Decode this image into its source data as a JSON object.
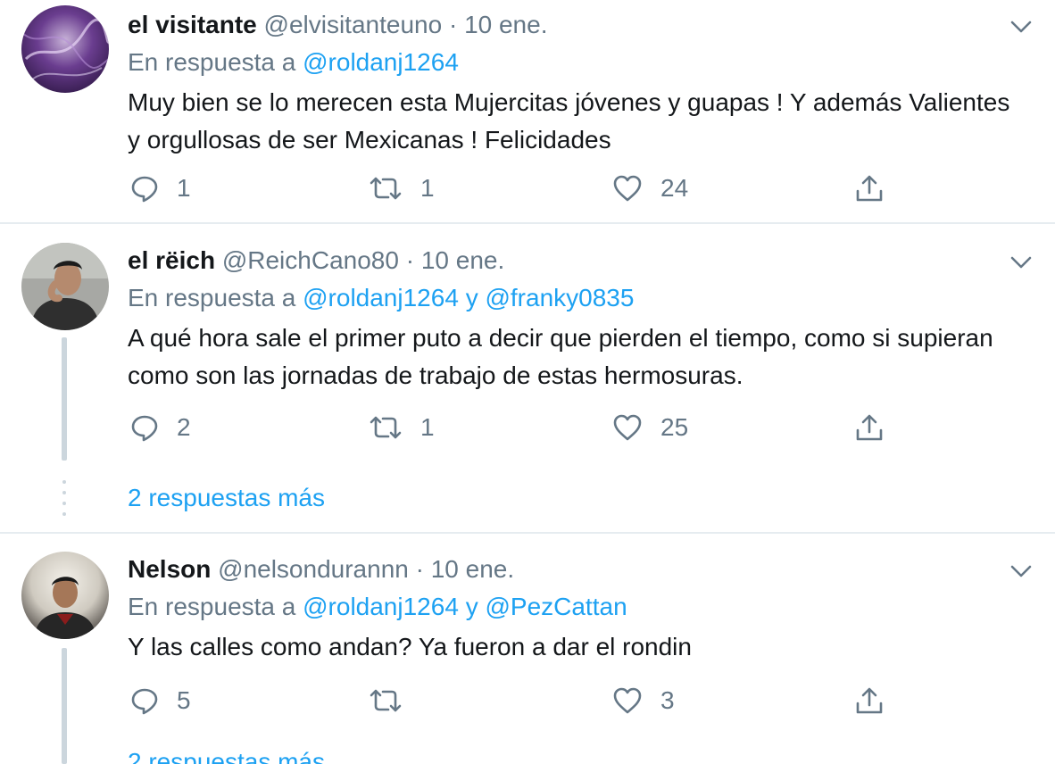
{
  "tweets": [
    {
      "name": "el visitante",
      "handle": "@elvisitanteuno",
      "separator": "·",
      "date": "10 ene.",
      "reply_prefix": "En respuesta a",
      "mentions": [
        "@roldanj1264"
      ],
      "conjunction": "",
      "text": "Muy bien se lo merecen esta Mujercitas jóvenes y guapas ! Y además Valientes y orgullosas de ser Mexicanas ! Felicidades",
      "replies": "1",
      "retweets": "1",
      "likes": "24",
      "avatar_icon": "avatar-purple-abstract"
    },
    {
      "name": "el rëich",
      "handle": "@ReichCano80",
      "separator": "·",
      "date": "10 ene.",
      "reply_prefix": "En respuesta a",
      "mentions": [
        "@roldanj1264",
        "@franky0835"
      ],
      "conjunction": "y",
      "text": "A qué hora sale el primer puto  a decir que pierden el tiempo, como si supieran como son las jornadas de trabajo de estas hermosuras.",
      "replies": "2",
      "retweets": "1",
      "likes": "25",
      "avatar_icon": "avatar-man-photo"
    },
    {
      "name": "Nelson",
      "handle": "@nelsondurannn",
      "separator": "·",
      "date": "10 ene.",
      "reply_prefix": "En respuesta a",
      "mentions": [
        "@roldanj1264",
        "@PezCattan"
      ],
      "conjunction": "y",
      "text": "Y las calles como andan? Ya fueron a dar el rondin",
      "replies": "5",
      "retweets": "",
      "likes": "3",
      "avatar_icon": "avatar-man-photo"
    }
  ],
  "more_replies_label": "2 respuestas más",
  "icons": {
    "reply": "reply-icon",
    "retweet": "retweet-icon",
    "like": "heart-icon",
    "share": "share-icon",
    "menu": "chevron-down-icon"
  },
  "colors": {
    "link": "#1da1f2",
    "secondary": "#657786",
    "primary_text": "#14171a",
    "divider": "#e6ecf0"
  }
}
